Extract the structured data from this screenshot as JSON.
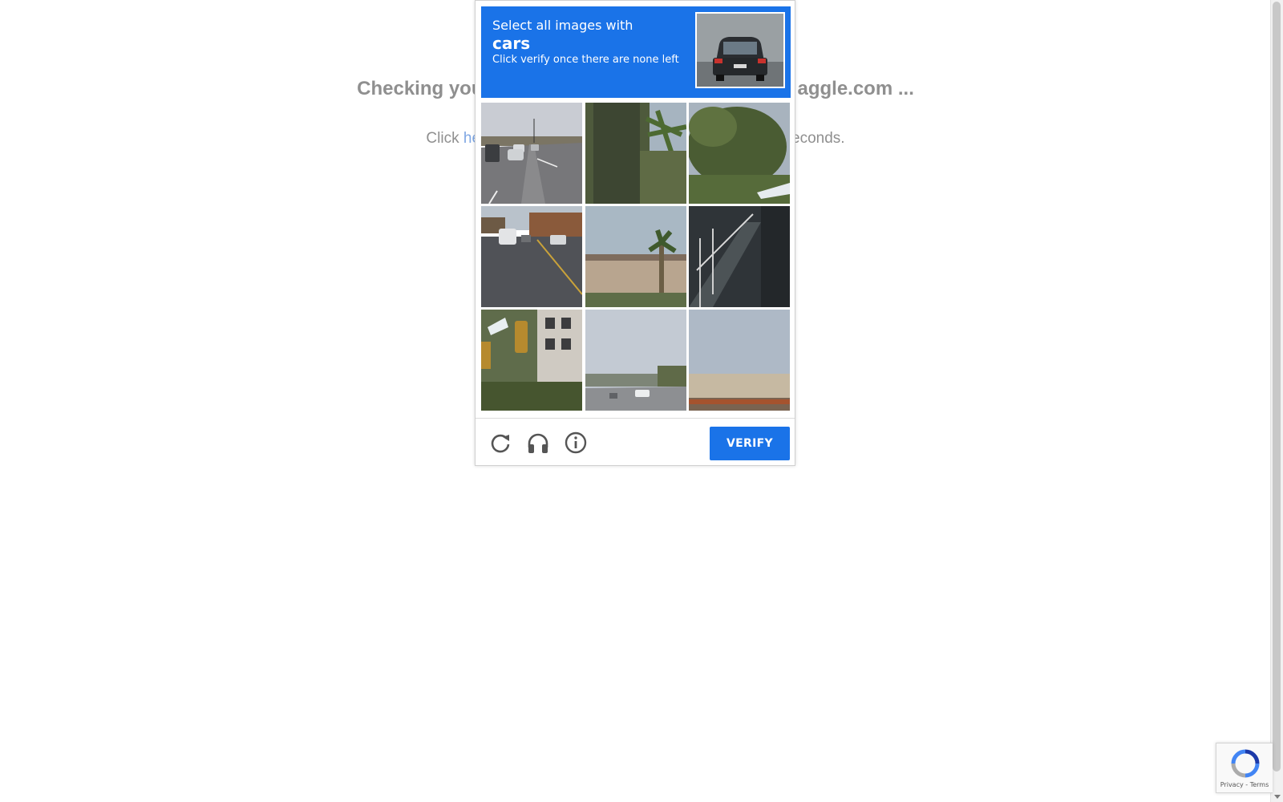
{
  "background_page": {
    "heading": "Checking you",
    "heading_suffix": "aggle.com ...",
    "line_prefix": "Click ",
    "line_link": "he",
    "line_suffix": "econds."
  },
  "challenge": {
    "instruction": "Select all images with",
    "target_word": "cars",
    "hint": "Click verify once there are none left",
    "header_color": "#1a73e8",
    "tiles": [
      {
        "name": "tile-1-road-with-cars"
      },
      {
        "name": "tile-2-palm-trunk"
      },
      {
        "name": "tile-3-palm-tree"
      },
      {
        "name": "tile-4-street-with-cars"
      },
      {
        "name": "tile-5-building-palm"
      },
      {
        "name": "tile-6-stairs"
      },
      {
        "name": "tile-7-traffic-light"
      },
      {
        "name": "tile-8-street-distance"
      },
      {
        "name": "tile-9-train-sky"
      }
    ],
    "footer": {
      "reload_icon": "reload-icon",
      "audio_icon": "headphones-icon",
      "info_icon": "info-icon",
      "verify_label": "VERIFY"
    }
  },
  "badge": {
    "text": "Privacy - Terms"
  }
}
